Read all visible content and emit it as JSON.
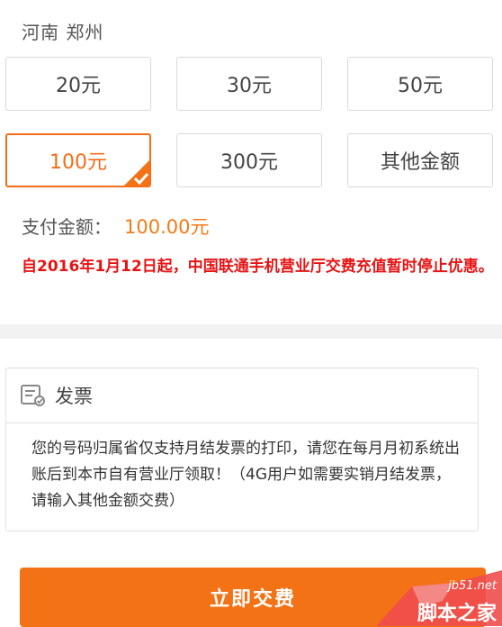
{
  "location": "河南 郑州",
  "amounts": [
    {
      "label": "20元",
      "selected": false
    },
    {
      "label": "30元",
      "selected": false
    },
    {
      "label": "50元",
      "selected": false
    },
    {
      "label": "100元",
      "selected": true
    },
    {
      "label": "300元",
      "selected": false
    },
    {
      "label": "其他金额",
      "selected": false
    }
  ],
  "payment": {
    "label": "支付金额：",
    "value": "100.00元"
  },
  "notice": "自2016年1月12日起，中国联通手机营业厅交费充值暂时停止优惠。",
  "invoice": {
    "title": "发票",
    "icon": "invoice-icon",
    "body": "您的号码归属省仅支持月结发票的打印，请您在每月月初系统出账后到本市自有营业厅领取！（4G用户如需要实销月结发票，请输入其他金额交费）"
  },
  "submit_label": "立即交费",
  "watermark": {
    "site": "jb51.net",
    "name": "脚本之家"
  },
  "colors": {
    "accent": "#f47216",
    "notice": "#e61414",
    "border": "#d9d9d9"
  }
}
